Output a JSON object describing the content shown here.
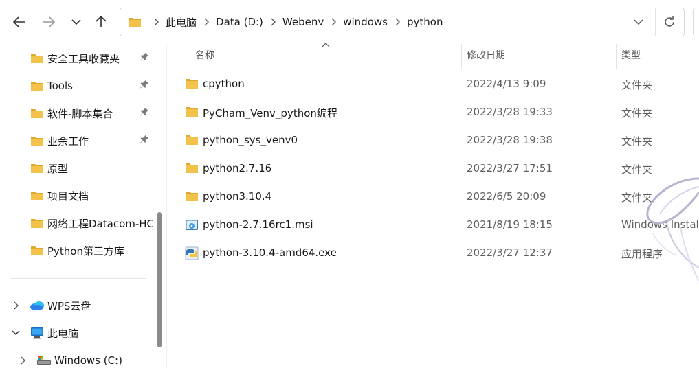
{
  "toolbar": {
    "back_icon": "arrow-left-icon",
    "forward_icon": "arrow-right-icon",
    "recent_icon": "chevron-down-icon",
    "up_icon": "arrow-up-icon"
  },
  "address_bar": {
    "breadcrumbs": [
      "此电脑",
      "Data (D:)",
      "Webenv",
      "windows",
      "python"
    ],
    "refresh_icon": "refresh-icon",
    "dropdown_icon": "chevron-down-icon"
  },
  "sidebar": {
    "quick_access": [
      {
        "label": "安全工具收藏夹",
        "pinned": true
      },
      {
        "label": "Tools",
        "pinned": true
      },
      {
        "label": "软件-脚本集合",
        "pinned": true
      },
      {
        "label": "业余工作",
        "pinned": true
      },
      {
        "label": "原型",
        "pinned": false
      },
      {
        "label": "项目文档",
        "pinned": false
      },
      {
        "label": "网络工程Datacom-HC",
        "pinned": false
      },
      {
        "label": "Python第三方库",
        "pinned": false
      }
    ],
    "wps_cloud": "WPS云盘",
    "this_pc": "此电脑",
    "drive_c": "Windows (C:)"
  },
  "file_list": {
    "columns": {
      "name": "名称",
      "modified": "修改日期",
      "type": "类型"
    },
    "rows": [
      {
        "name": "cpython",
        "modified": "2022/4/13 9:09",
        "type": "文件夹",
        "icon": "folder-icon"
      },
      {
        "name": "PyCham_Venv_python编程",
        "modified": "2022/3/28 19:33",
        "type": "文件夹",
        "icon": "folder-icon"
      },
      {
        "name": "python_sys_venv0",
        "modified": "2022/3/28 19:38",
        "type": "文件夹",
        "icon": "folder-icon"
      },
      {
        "name": "python2.7.16",
        "modified": "2022/3/27 17:51",
        "type": "文件夹",
        "icon": "folder-icon"
      },
      {
        "name": "python3.10.4",
        "modified": "2022/6/5 20:09",
        "type": "文件夹",
        "icon": "folder-icon"
      },
      {
        "name": "python-2.7.16rc1.msi",
        "modified": "2021/8/19 18:15",
        "type": "Windows Install",
        "icon": "msi-installer-icon"
      },
      {
        "name": "python-3.10.4-amd64.exe",
        "modified": "2022/3/27 12:37",
        "type": "应用程序",
        "icon": "python-exe-icon"
      }
    ]
  },
  "colors": {
    "folder": "#f3c24a",
    "folder_dark": "#e0a82e",
    "accent": "#0067c0"
  }
}
